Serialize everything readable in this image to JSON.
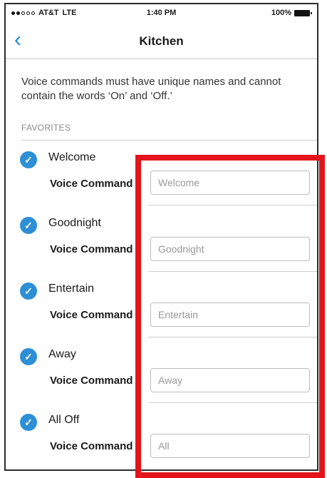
{
  "status_bar": {
    "carrier": "AT&T",
    "network": "LTE",
    "time": "1:40 PM",
    "battery": "100%",
    "battery_icon": "battery-full-icon",
    "signal_icon": "signal-dots-icon"
  },
  "nav": {
    "back_icon": "chevron-left-icon",
    "title": "Kitchen"
  },
  "info_text": "Voice commands must have unique names and cannot contain the words ‘On’ and ‘Off.’",
  "section_header": "FAVORITES",
  "voice_command_label": "Voice Command",
  "favorites": [
    {
      "name": "Welcome",
      "voice_command_value": "Welcome"
    },
    {
      "name": "Goodnight",
      "voice_command_value": "Goodnight"
    },
    {
      "name": "Entertain",
      "voice_command_value": "Entertain"
    },
    {
      "name": "Away",
      "voice_command_value": "Away"
    },
    {
      "name": "All Off",
      "voice_command_value": "All"
    }
  ],
  "colors": {
    "accent": "#2d8fd5",
    "back_arrow": "#1e88d8",
    "highlight_box": "#e3141b"
  }
}
